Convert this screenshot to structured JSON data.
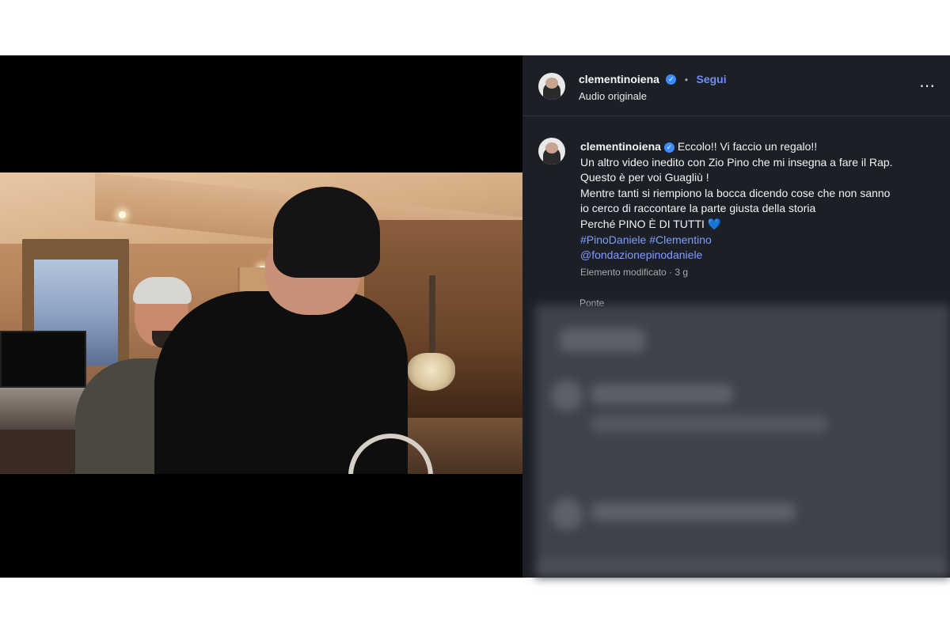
{
  "post": {
    "username": "clementinoiena",
    "follow_label": "Segui",
    "audio_label": "Audio originale",
    "more_icon": "⋯",
    "caption": {
      "username": "clementinoiena",
      "lines": [
        "Eccolo!! Vi faccio un regalo!!",
        "Un altro video inedito con Zio Pino che mi insegna a fare il Rap.",
        "Questo è per voi Guagliù !",
        "Mentre tanti si riempiono la bocca dicendo cose che non sanno",
        "io cerco di raccontare la parte giusta della storia",
        "Perché PINO È DI TUTTI 💙"
      ],
      "hashtag_1": "#PinoDaniele",
      "hashtag_2": "#Clementino",
      "mention": "@fondazionepinodaniele"
    },
    "meta": "Elemento modificato · 3 g",
    "partial_text": "Ponte"
  },
  "video": {
    "audio_icon": "speaker-icon"
  },
  "colors": {
    "panel_bg": "#1c2026",
    "link": "#6c8cff",
    "hashtag": "#7f9cff",
    "verified": "#3b8cff"
  }
}
